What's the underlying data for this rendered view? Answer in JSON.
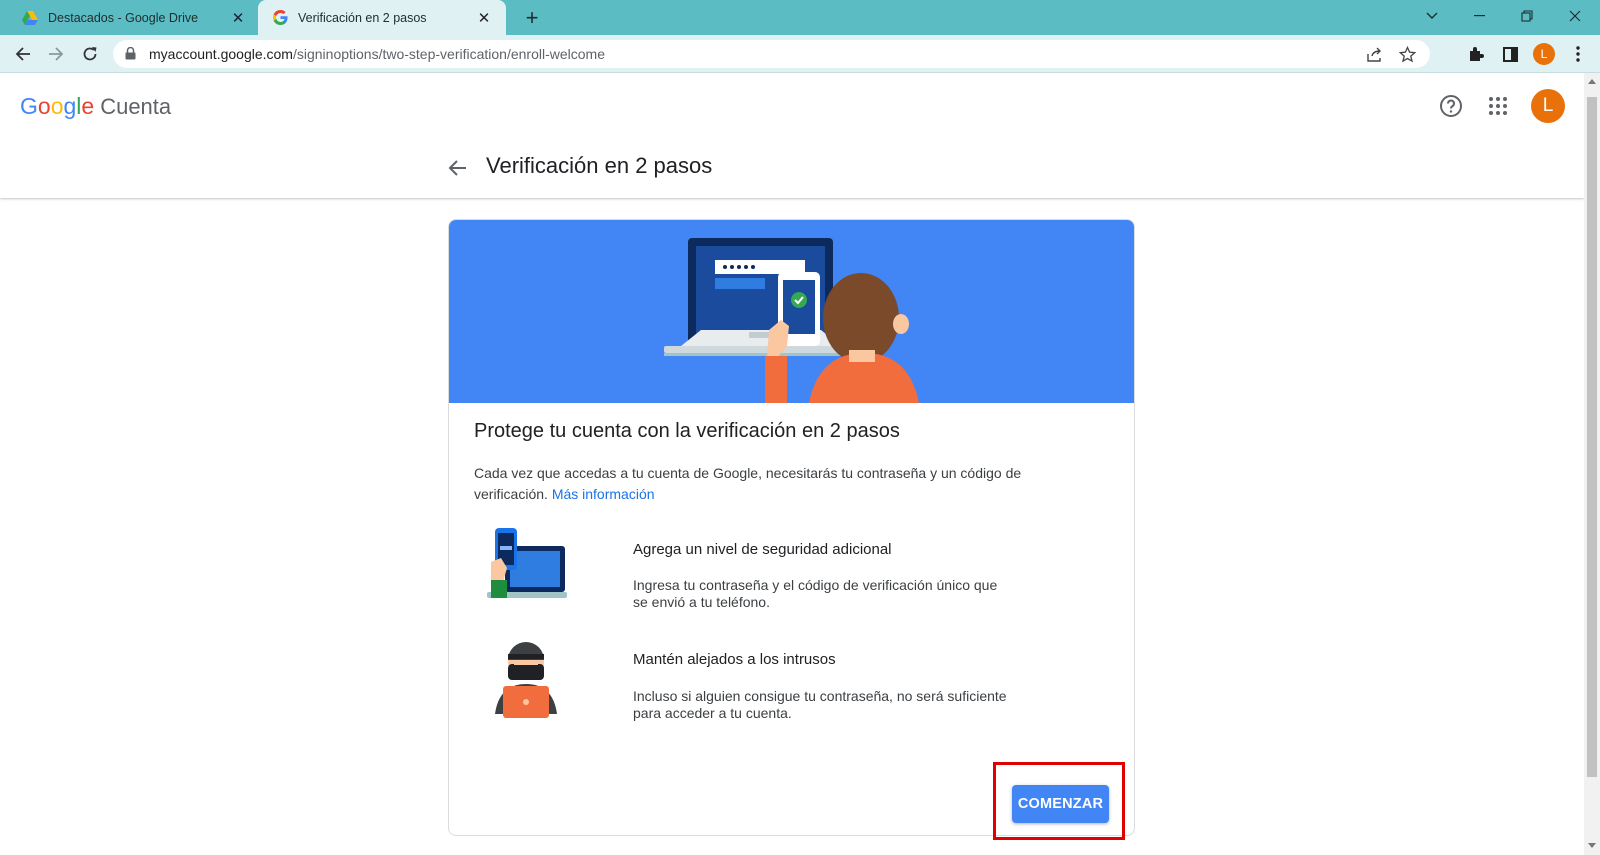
{
  "browser": {
    "tabs": [
      {
        "title": "Destacados - Google Drive",
        "active": false,
        "icon": "google-drive-icon"
      },
      {
        "title": "Verificación en 2 pasos",
        "active": true,
        "icon": "google-g-icon"
      }
    ],
    "url_host": "myaccount.google.com",
    "url_path": "/signinoptions/two-step-verification/enroll-welcome",
    "profile_initial": "L",
    "profile_color": "#e8710a"
  },
  "header": {
    "logo": {
      "G": "G",
      "o1": "o",
      "o2": "o",
      "g": "g",
      "l": "l",
      "e": "e"
    },
    "product": "Cuenta",
    "avatar_initial": "L"
  },
  "page": {
    "title": "Verificación en 2 pasos"
  },
  "card": {
    "heading": "Protege tu cuenta con la verificación en 2 pasos",
    "description": "Cada vez que accedas a tu cuenta de Google, necesitarás tu contraseña y un código de verificación.",
    "link": "Más información",
    "features": [
      {
        "title": "Agrega un nivel de seguridad adicional",
        "text": "Ingresa tu contraseña y el código de verificación único que se envió a tu teléfono."
      },
      {
        "title": "Mantén alejados a los intrusos",
        "text": "Incluso si alguien consigue tu contraseña, no será suficiente para acceder a tu cuenta."
      }
    ],
    "start_button": "COMENZAR"
  },
  "colors": {
    "accent_blue": "#4285f4",
    "link_blue": "#1a73e8",
    "highlight_red": "#e00000",
    "chrome_frame": "#5bbcc4"
  }
}
